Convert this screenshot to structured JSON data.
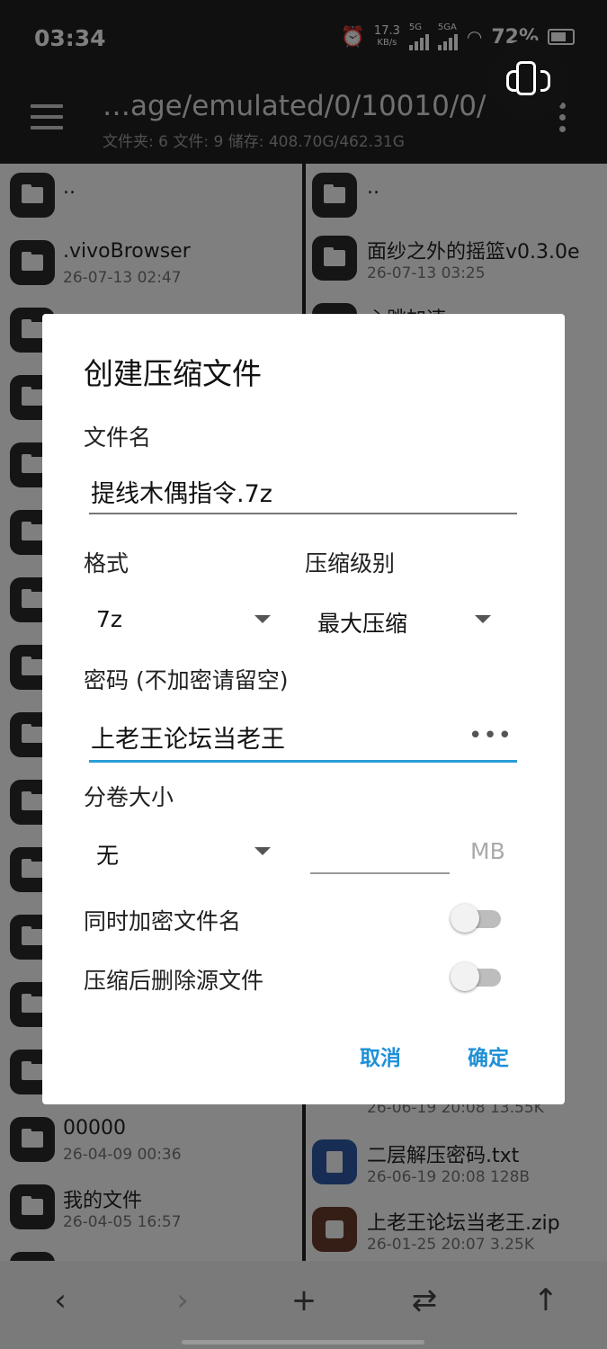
{
  "status": {
    "time": "03:34",
    "speed_top": "17.3",
    "speed_bottom": "KB/s",
    "sim1": "5G",
    "sim2": "5GA",
    "battery": "72%"
  },
  "toolbar": {
    "path": "…age/emulated/0/10010/0/",
    "subtitle": "文件夹: 6  文件: 9  储存: 408.70G/462.31G"
  },
  "left_pane": {
    "items": [
      {
        "name": "..",
        "date": ""
      },
      {
        "name": ".vivoBrowser",
        "date": "26-07-13 02:47"
      },
      {
        "name": "00000",
        "date": "26-04-09 00:36"
      },
      {
        "name": "我的文件",
        "date": "26-04-05 16:57"
      }
    ]
  },
  "right_pane": {
    "items": [
      {
        "name": "..",
        "date": ""
      },
      {
        "name": "面纱之外的摇篮v0.3.0e",
        "date": "26-07-13 03:25"
      },
      {
        "name": "心跳加速",
        "date": ""
      },
      {
        "name": "",
        "date": "26-06-19 20:08  13.55K"
      },
      {
        "name": "二层解压密码.txt",
        "date": "26-06-19 20:08  128B"
      },
      {
        "name": "上老王论坛当老王.zip",
        "date": "26-01-25 20:07  3.25K"
      }
    ]
  },
  "dialog": {
    "title": "创建压缩文件",
    "filename_label": "文件名",
    "filename_value": "提线木偶指令.7z",
    "format_label": "格式",
    "format_value": "7z",
    "level_label": "压缩级别",
    "level_value": "最大压缩",
    "password_label": "密码 (不加密请留空)",
    "password_value": "上老王论坛当老王",
    "password_reveal": "•••",
    "volume_label": "分卷大小",
    "volume_value": "无",
    "volume_unit": "MB",
    "encrypt_names_label": "同时加密文件名",
    "encrypt_names_on": false,
    "delete_source_label": "压缩后删除源文件",
    "delete_source_on": false,
    "cancel": "取消",
    "confirm": "确定"
  },
  "bottombar": {
    "back": "‹",
    "forward": "›",
    "add": "+",
    "swap": "⇄",
    "up": "↑"
  },
  "colors": {
    "accent": "#1e90d6",
    "toolbar_bg": "#202020"
  }
}
